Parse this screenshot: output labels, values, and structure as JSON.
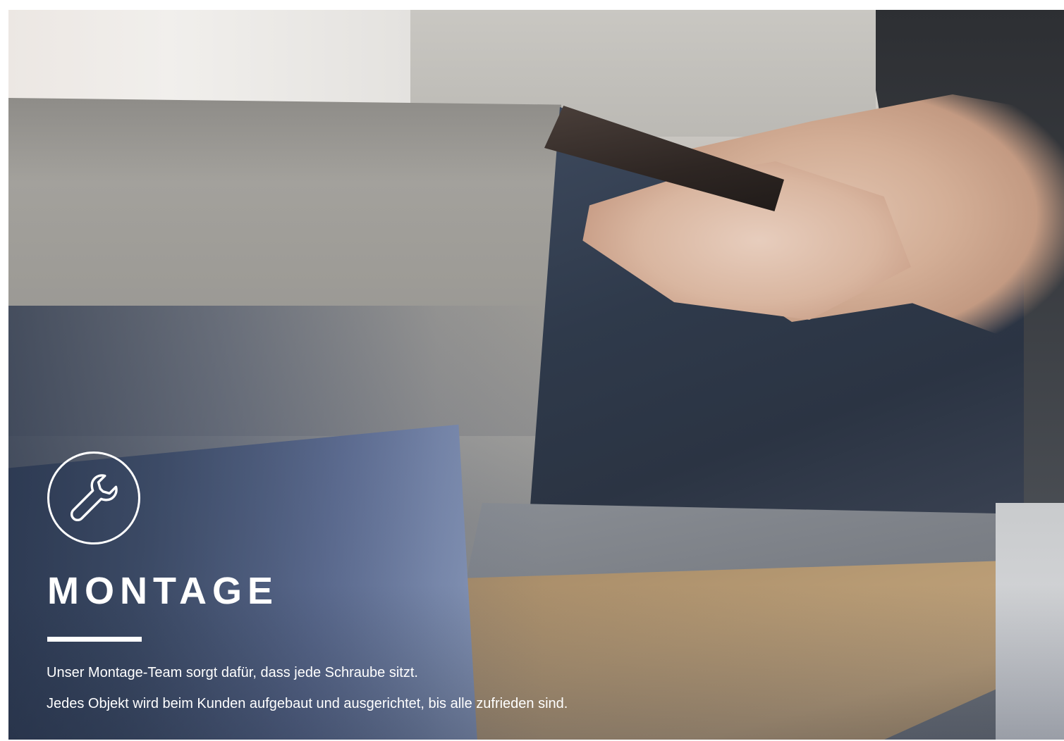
{
  "hero": {
    "icon": "wrench-icon",
    "title": "MONTAGE",
    "lines": [
      "Unser Montage-Team sorgt dafür, dass jede Schraube sitzt.",
      "Jedes Objekt wird beim Kunden aufgebaut und ausgerichtet, bis alle zufrieden sind."
    ]
  },
  "colors": {
    "text": "#ffffff",
    "accent_rule": "#ffffff",
    "page_background": "#ffffff"
  }
}
